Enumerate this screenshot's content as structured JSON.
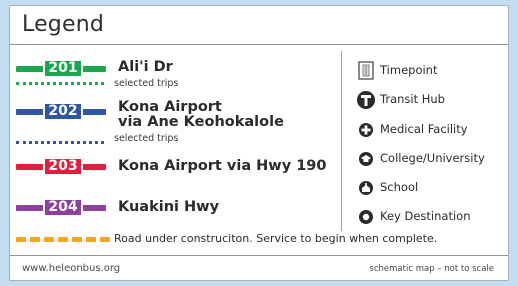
{
  "legend": {
    "title": "Legend",
    "routes": [
      {
        "number": "201",
        "color": "#1aa84f",
        "label_lines": [
          "Ali'i Dr"
        ],
        "selected_trips": "selected trips",
        "dotted_color": "#1aa84f"
      },
      {
        "number": "202",
        "color": "#2f55a7",
        "label_lines": [
          "Kona Airport",
          "via Ane Keohokalole"
        ],
        "selected_trips": "selected trips",
        "dotted_color": "#2f55a7"
      },
      {
        "number": "203",
        "color": "#e01f3d",
        "label_lines": [
          "Kona Airport via Hwy 190"
        ],
        "selected_trips": "",
        "dotted_color": ""
      },
      {
        "number": "204",
        "color": "#8e3fa0",
        "label_lines": [
          "Kuakini Hwy"
        ],
        "selected_trips": "",
        "dotted_color": ""
      }
    ],
    "symbols": [
      {
        "icon": "timepoint-icon",
        "label": "Timepoint"
      },
      {
        "icon": "transit-hub-icon",
        "label": "Transit Hub"
      },
      {
        "icon": "medical-facility-icon",
        "label": "Medical Facility"
      },
      {
        "icon": "college-university-icon",
        "label": "College/University"
      },
      {
        "icon": "school-icon",
        "label": "School"
      },
      {
        "icon": "key-destination-icon",
        "label": "Key Destination"
      }
    ],
    "construction": {
      "label": "Road under construciton. Service to begin when complete.",
      "color": "#f5a623"
    },
    "footer": {
      "website": "www.heleonbus.org",
      "note": "schematic map – not to scale"
    }
  }
}
